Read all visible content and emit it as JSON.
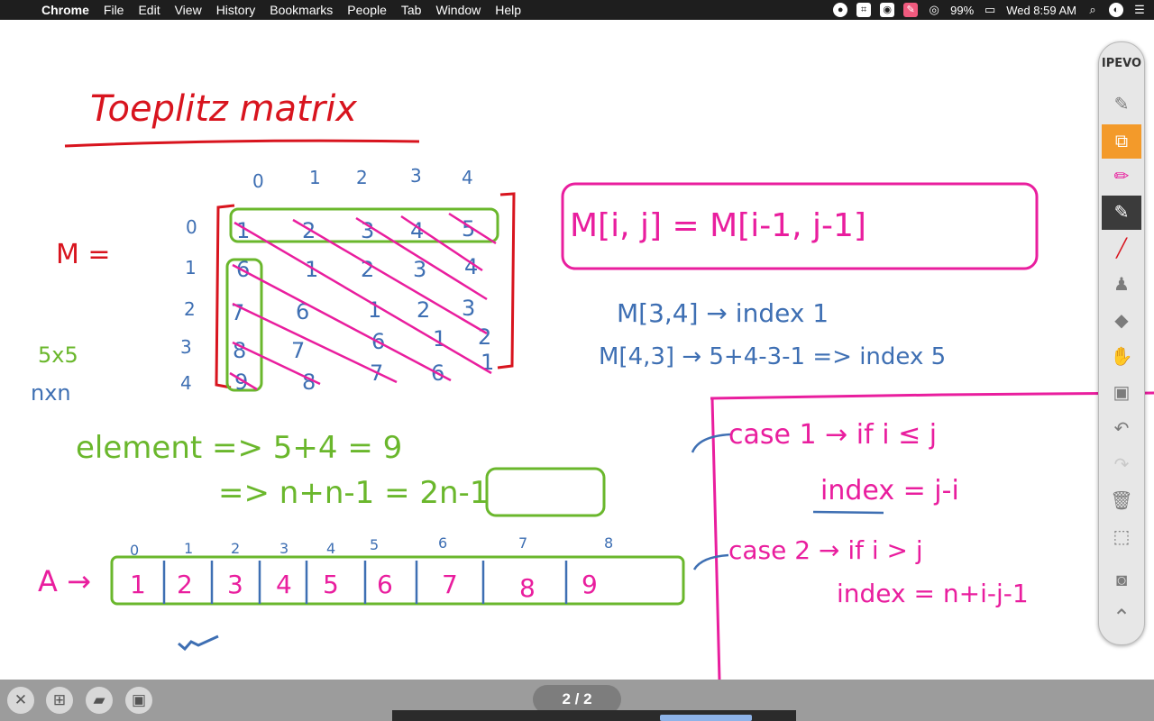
{
  "menubar": {
    "app_name": "Chrome",
    "menus": [
      "File",
      "Edit",
      "View",
      "History",
      "Bookmarks",
      "People",
      "Tab",
      "Window",
      "Help"
    ],
    "battery": "99%",
    "clock": "Wed 8:59 AM",
    "status_icons": [
      "record-icon",
      "crop-icon",
      "camera-icon",
      "pen-icon",
      "eye-icon",
      "battery-icon",
      "search-icon",
      "siri-icon",
      "list-icon"
    ]
  },
  "whiteboard": {
    "title": "Toeplitz matrix",
    "matrix_name": "M =",
    "col_indices": [
      "0",
      "1",
      "2",
      "3",
      "4"
    ],
    "row_indices": [
      "0",
      "1",
      "2",
      "3",
      "4"
    ],
    "matrix_rows": [
      [
        "1",
        "2",
        "3",
        "4",
        "5"
      ],
      [
        "6",
        "1",
        "2",
        "3",
        "4"
      ],
      [
        "7",
        "6",
        "1",
        "2",
        "3"
      ],
      [
        "8",
        "7",
        "6",
        "1",
        "2"
      ],
      [
        "9",
        "8",
        "7",
        "6",
        "1"
      ]
    ],
    "size_label": "5x5",
    "size_general": "nxn",
    "formula_box": "M[i, j] = M[i-1, j-1]",
    "example1": "M[3,4] → index 1",
    "example2": "M[4,3] → 5+4-3-1 => index 5",
    "elements_line1": "element => 5+4 = 9",
    "elements_line2": "=> n+n-1 = 2n-1",
    "array_label": "A →",
    "array_indices": [
      "0",
      "1",
      "2",
      "3",
      "4",
      "5",
      "6",
      "7",
      "8"
    ],
    "array_values": [
      "1",
      "2",
      "3",
      "4",
      "5",
      "6",
      "7",
      "8",
      "9"
    ],
    "case1": "case 1 → if i ≤ j",
    "case1_index": "index = j-i",
    "case2": "case 2 → if i > j",
    "case2_index": "index = n+i-j-1",
    "colors": {
      "red": "#d8141e",
      "green": "#6ab72c",
      "blue": "#3e6fb3",
      "magenta": "#e91e9e"
    }
  },
  "toolbar": {
    "brand": "IPEVO",
    "tools": [
      {
        "name": "scribble-tool-icon",
        "glyph": "✎",
        "state": "normal"
      },
      {
        "name": "whiteboard-select-icon",
        "glyph": "⧉",
        "state": "orange"
      },
      {
        "name": "highlighter-icon",
        "glyph": "✏",
        "state": "normal"
      },
      {
        "name": "pen-icon",
        "glyph": "✎",
        "state": "dark"
      },
      {
        "name": "line-icon",
        "glyph": "╱",
        "state": "normal"
      },
      {
        "name": "stamp-icon",
        "glyph": "♟",
        "state": "normal"
      },
      {
        "name": "eraser-icon",
        "glyph": "◆",
        "state": "normal"
      },
      {
        "name": "hand-icon",
        "glyph": "✋",
        "state": "normal"
      },
      {
        "name": "toolbox-icon",
        "glyph": "▣",
        "state": "normal"
      },
      {
        "name": "undo-icon",
        "glyph": "↶",
        "state": "normal"
      },
      {
        "name": "redo-icon",
        "glyph": "↷",
        "state": "disabled"
      },
      {
        "name": "trash-icon",
        "glyph": "🗑",
        "state": "normal"
      },
      {
        "name": "capture-settings-icon",
        "glyph": "⬚",
        "state": "normal"
      },
      {
        "name": "camera-icon",
        "glyph": "◙",
        "state": "normal"
      },
      {
        "name": "collapse-chevron-icon",
        "glyph": "⌃",
        "state": "normal"
      }
    ]
  },
  "bottombar": {
    "page_indicator": "2 / 2",
    "buttons": [
      "close-icon",
      "new-page-icon",
      "open-folder-icon",
      "save-icon"
    ]
  }
}
